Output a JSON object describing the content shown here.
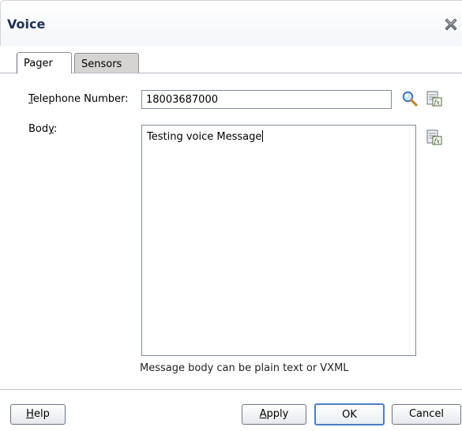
{
  "dialog": {
    "title": "Voice"
  },
  "tabs": [
    {
      "label": "Pager",
      "active": true
    },
    {
      "label": "Sensors",
      "active": false
    }
  ],
  "form": {
    "telephone_label_mnemonic": "T",
    "telephone_label_rest": "elephone Number:",
    "telephone_value": "18003687000",
    "body_label_prefix": "Bod",
    "body_label_mnemonic": "y",
    "body_label_suffix": ":",
    "body_value": "Testing voice Message",
    "hint": "Message body can be plain text or VXML"
  },
  "icons": {
    "close": "close-icon",
    "search": "search-icon",
    "expression": "expression-builder-icon"
  },
  "buttons": {
    "help_mnemonic": "H",
    "help_rest": "elp",
    "apply_mnemonic": "A",
    "apply_rest": "pply",
    "ok": "OK",
    "cancel": "Cancel"
  },
  "colors": {
    "title": "#1d2f56",
    "ok_border": "#4a7ec9",
    "inactive_tab": "#d6d4d2"
  }
}
